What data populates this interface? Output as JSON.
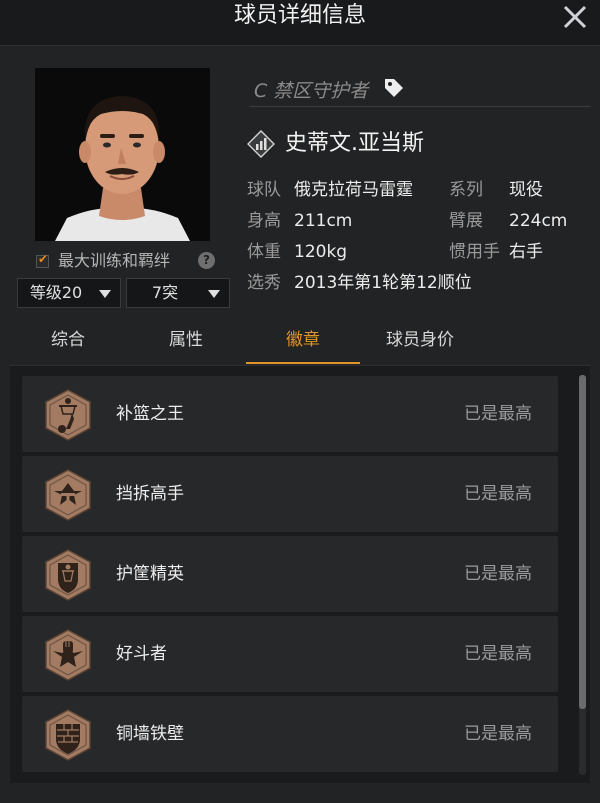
{
  "header": {
    "title": "球员详细信息"
  },
  "player": {
    "position_label": "C 禁区守护者",
    "name": "史蒂文.亚当斯",
    "attributes": {
      "team_label": "球队",
      "team_value": "俄克拉荷马雷霆",
      "series_label": "系列",
      "series_value": "现役",
      "height_label": "身高",
      "height_value": "211cm",
      "wingspan_label": "臂展",
      "wingspan_value": "224cm",
      "weight_label": "体重",
      "weight_value": "120kg",
      "hand_label": "惯用手",
      "hand_value": "右手",
      "draft_label": "选秀",
      "draft_value": "2013年第1轮第12顺位"
    }
  },
  "controls": {
    "max_training_label": "最大训练和羁绊",
    "max_training_checked": true,
    "help_glyph": "?",
    "level_select": "等级20",
    "breakthrough_select": "7突"
  },
  "tabs": [
    "综合",
    "属性",
    "徽章",
    "球员身价"
  ],
  "active_tab": "徽章",
  "badges": [
    {
      "name": "补篮之王",
      "status": "已是最高",
      "icon": "putback-icon"
    },
    {
      "name": "挡拆高手",
      "status": "已是最高",
      "icon": "pick-roll-icon"
    },
    {
      "name": "护筐精英",
      "status": "已是最高",
      "icon": "rim-protector-icon"
    },
    {
      "name": "好斗者",
      "status": "已是最高",
      "icon": "brawler-icon"
    },
    {
      "name": "铜墙铁壁",
      "status": "已是最高",
      "icon": "brick-wall-icon"
    }
  ],
  "colors": {
    "accent": "#e0952a",
    "background": "#222324",
    "badge_bronze": "#a27b62"
  }
}
